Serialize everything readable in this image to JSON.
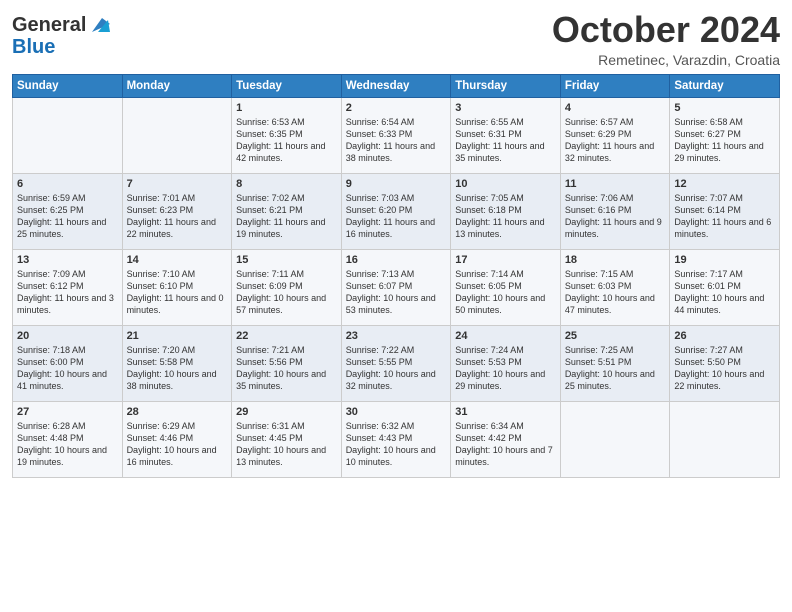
{
  "header": {
    "logo_general": "General",
    "logo_blue": "Blue",
    "month_title": "October 2024",
    "location": "Remetinec, Varazdin, Croatia"
  },
  "weekdays": [
    "Sunday",
    "Monday",
    "Tuesday",
    "Wednesday",
    "Thursday",
    "Friday",
    "Saturday"
  ],
  "weeks": [
    [
      {
        "day": "",
        "info": ""
      },
      {
        "day": "",
        "info": ""
      },
      {
        "day": "1",
        "info": "Sunrise: 6:53 AM\nSunset: 6:35 PM\nDaylight: 11 hours and 42 minutes."
      },
      {
        "day": "2",
        "info": "Sunrise: 6:54 AM\nSunset: 6:33 PM\nDaylight: 11 hours and 38 minutes."
      },
      {
        "day": "3",
        "info": "Sunrise: 6:55 AM\nSunset: 6:31 PM\nDaylight: 11 hours and 35 minutes."
      },
      {
        "day": "4",
        "info": "Sunrise: 6:57 AM\nSunset: 6:29 PM\nDaylight: 11 hours and 32 minutes."
      },
      {
        "day": "5",
        "info": "Sunrise: 6:58 AM\nSunset: 6:27 PM\nDaylight: 11 hours and 29 minutes."
      }
    ],
    [
      {
        "day": "6",
        "info": "Sunrise: 6:59 AM\nSunset: 6:25 PM\nDaylight: 11 hours and 25 minutes."
      },
      {
        "day": "7",
        "info": "Sunrise: 7:01 AM\nSunset: 6:23 PM\nDaylight: 11 hours and 22 minutes."
      },
      {
        "day": "8",
        "info": "Sunrise: 7:02 AM\nSunset: 6:21 PM\nDaylight: 11 hours and 19 minutes."
      },
      {
        "day": "9",
        "info": "Sunrise: 7:03 AM\nSunset: 6:20 PM\nDaylight: 11 hours and 16 minutes."
      },
      {
        "day": "10",
        "info": "Sunrise: 7:05 AM\nSunset: 6:18 PM\nDaylight: 11 hours and 13 minutes."
      },
      {
        "day": "11",
        "info": "Sunrise: 7:06 AM\nSunset: 6:16 PM\nDaylight: 11 hours and 9 minutes."
      },
      {
        "day": "12",
        "info": "Sunrise: 7:07 AM\nSunset: 6:14 PM\nDaylight: 11 hours and 6 minutes."
      }
    ],
    [
      {
        "day": "13",
        "info": "Sunrise: 7:09 AM\nSunset: 6:12 PM\nDaylight: 11 hours and 3 minutes."
      },
      {
        "day": "14",
        "info": "Sunrise: 7:10 AM\nSunset: 6:10 PM\nDaylight: 11 hours and 0 minutes."
      },
      {
        "day": "15",
        "info": "Sunrise: 7:11 AM\nSunset: 6:09 PM\nDaylight: 10 hours and 57 minutes."
      },
      {
        "day": "16",
        "info": "Sunrise: 7:13 AM\nSunset: 6:07 PM\nDaylight: 10 hours and 53 minutes."
      },
      {
        "day": "17",
        "info": "Sunrise: 7:14 AM\nSunset: 6:05 PM\nDaylight: 10 hours and 50 minutes."
      },
      {
        "day": "18",
        "info": "Sunrise: 7:15 AM\nSunset: 6:03 PM\nDaylight: 10 hours and 47 minutes."
      },
      {
        "day": "19",
        "info": "Sunrise: 7:17 AM\nSunset: 6:01 PM\nDaylight: 10 hours and 44 minutes."
      }
    ],
    [
      {
        "day": "20",
        "info": "Sunrise: 7:18 AM\nSunset: 6:00 PM\nDaylight: 10 hours and 41 minutes."
      },
      {
        "day": "21",
        "info": "Sunrise: 7:20 AM\nSunset: 5:58 PM\nDaylight: 10 hours and 38 minutes."
      },
      {
        "day": "22",
        "info": "Sunrise: 7:21 AM\nSunset: 5:56 PM\nDaylight: 10 hours and 35 minutes."
      },
      {
        "day": "23",
        "info": "Sunrise: 7:22 AM\nSunset: 5:55 PM\nDaylight: 10 hours and 32 minutes."
      },
      {
        "day": "24",
        "info": "Sunrise: 7:24 AM\nSunset: 5:53 PM\nDaylight: 10 hours and 29 minutes."
      },
      {
        "day": "25",
        "info": "Sunrise: 7:25 AM\nSunset: 5:51 PM\nDaylight: 10 hours and 25 minutes."
      },
      {
        "day": "26",
        "info": "Sunrise: 7:27 AM\nSunset: 5:50 PM\nDaylight: 10 hours and 22 minutes."
      }
    ],
    [
      {
        "day": "27",
        "info": "Sunrise: 6:28 AM\nSunset: 4:48 PM\nDaylight: 10 hours and 19 minutes."
      },
      {
        "day": "28",
        "info": "Sunrise: 6:29 AM\nSunset: 4:46 PM\nDaylight: 10 hours and 16 minutes."
      },
      {
        "day": "29",
        "info": "Sunrise: 6:31 AM\nSunset: 4:45 PM\nDaylight: 10 hours and 13 minutes."
      },
      {
        "day": "30",
        "info": "Sunrise: 6:32 AM\nSunset: 4:43 PM\nDaylight: 10 hours and 10 minutes."
      },
      {
        "day": "31",
        "info": "Sunrise: 6:34 AM\nSunset: 4:42 PM\nDaylight: 10 hours and 7 minutes."
      },
      {
        "day": "",
        "info": ""
      },
      {
        "day": "",
        "info": ""
      }
    ]
  ]
}
